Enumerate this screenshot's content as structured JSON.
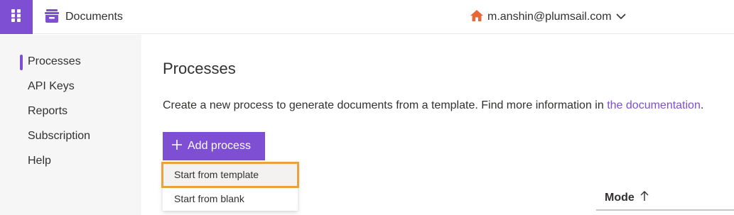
{
  "topbar": {
    "app_launcher_icon": "waffle-grid-icon",
    "brand_icon": "file-box-icon",
    "brand_title": "Documents",
    "account_icon": "home-icon",
    "account_email": "m.anshin@plumsail.com",
    "account_chevron": "chevron-down-icon"
  },
  "sidebar": {
    "items": [
      {
        "label": "Processes",
        "active": true
      },
      {
        "label": "API Keys",
        "active": false
      },
      {
        "label": "Reports",
        "active": false
      },
      {
        "label": "Subscription",
        "active": false
      },
      {
        "label": "Help",
        "active": false
      }
    ]
  },
  "main": {
    "title": "Processes",
    "description_prefix": "Create a new process to generate documents from a template. Find more information in ",
    "description_link": "the documentation",
    "description_suffix": ".",
    "add_button_label": "Add process",
    "add_button_icon": "plus-icon",
    "menu": [
      {
        "label": "Start from template",
        "highlighted": true
      },
      {
        "label": "Start from blank",
        "highlighted": false
      }
    ],
    "table": {
      "column_label": "Mode",
      "sort_icon": "arrow-up-icon"
    }
  },
  "colors": {
    "accent": "#7e4fd3",
    "home_icon": "#e8683a",
    "highlight_outline": "#e8a33d",
    "sidebar_bg": "#f6f6f6"
  }
}
